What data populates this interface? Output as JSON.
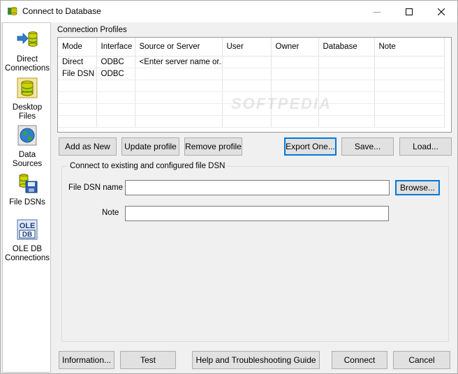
{
  "window": {
    "title": "Connect to Database"
  },
  "sidebar": {
    "items": [
      {
        "label_line1": "Direct",
        "label_line2": "Connections",
        "icon": "arrow-database-icon"
      },
      {
        "label_line1": "Desktop",
        "label_line2": "Files",
        "icon": "database-files-icon"
      },
      {
        "label_line1": "Data",
        "label_line2": "Sources",
        "icon": "globe-icon"
      },
      {
        "label_line1": "File DSNs",
        "label_line2": "",
        "icon": "file-dsn-icon"
      },
      {
        "label_line1": "OLE DB",
        "label_line2": "Connections",
        "icon": "oledb-icon",
        "icon_text_1": "OLE",
        "icon_text_2": "DB"
      }
    ]
  },
  "profiles": {
    "label": "Connection Profiles",
    "columns": [
      "Mode",
      "Interface",
      "Source or Server",
      "User",
      "Owner",
      "Database",
      "Note"
    ],
    "rows": [
      [
        "Direct",
        "ODBC",
        "<Enter server name or...",
        "",
        "",
        "",
        ""
      ],
      [
        "File DSN",
        "ODBC",
        "",
        "",
        "",
        "",
        ""
      ]
    ],
    "watermark": "SOFTPEDIA"
  },
  "profile_buttons": {
    "add": "Add as New",
    "update": "Update profile",
    "remove": "Remove profile",
    "export": "Export One...",
    "save": "Save...",
    "load": "Load..."
  },
  "file_dsn": {
    "group_label": "Connect to existing and configured file DSN",
    "dsn_label": "File DSN name",
    "dsn_value": "",
    "browse": "Browse...",
    "note_label": "Note",
    "note_value": ""
  },
  "bottom_buttons": {
    "information": "Information...",
    "test": "Test",
    "help": "Help and Troubleshooting Guide",
    "connect": "Connect",
    "cancel": "Cancel"
  },
  "colors": {
    "focus_border": "#0078d7",
    "button_face": "#e1e1e1",
    "window_bg": "#f0f0f0"
  }
}
